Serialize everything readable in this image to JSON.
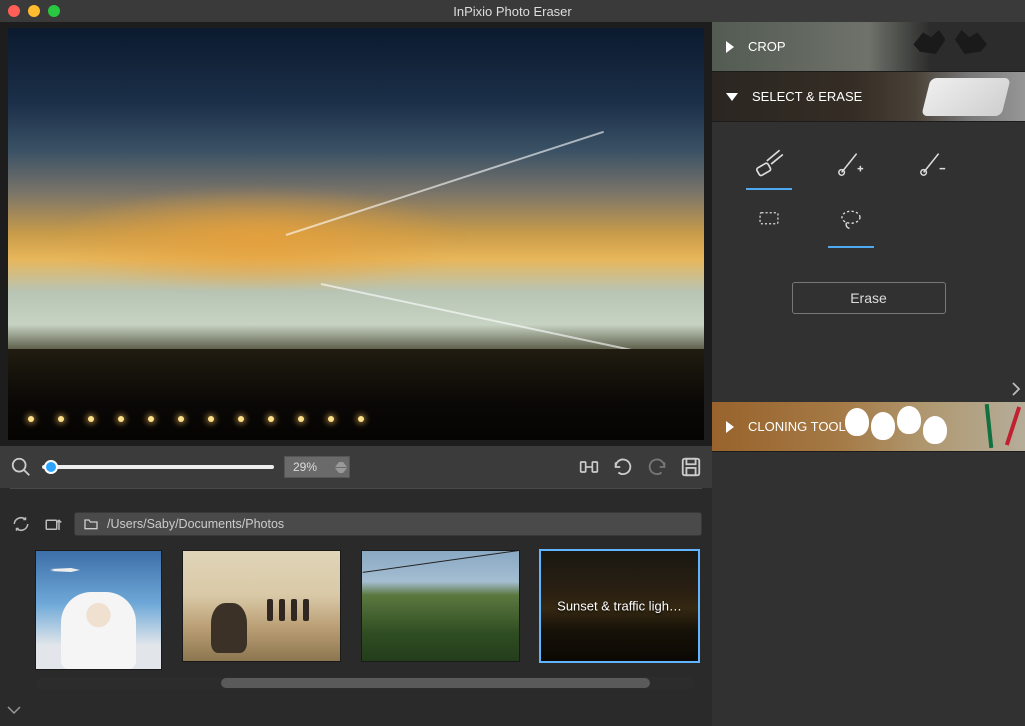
{
  "app": {
    "title": "InPixio Photo Eraser"
  },
  "canvas": {
    "zoom_percent": "29%"
  },
  "toolbar_bottom": {
    "fit_label": "fit-to-screen",
    "undo_label": "undo",
    "redo_label": "redo",
    "save_label": "save"
  },
  "filebrowser": {
    "path": "/Users/Saby/Documents/Photos",
    "thumbs": [
      {
        "label": ""
      },
      {
        "label": ""
      },
      {
        "label": ""
      },
      {
        "label": "Sunset & traffic ligh…"
      }
    ]
  },
  "panels": {
    "crop": "CROP",
    "erase": "SELECT & ERASE",
    "clone": "CLONING TOOL"
  },
  "erase_tools": {
    "button_label": "Erase"
  }
}
